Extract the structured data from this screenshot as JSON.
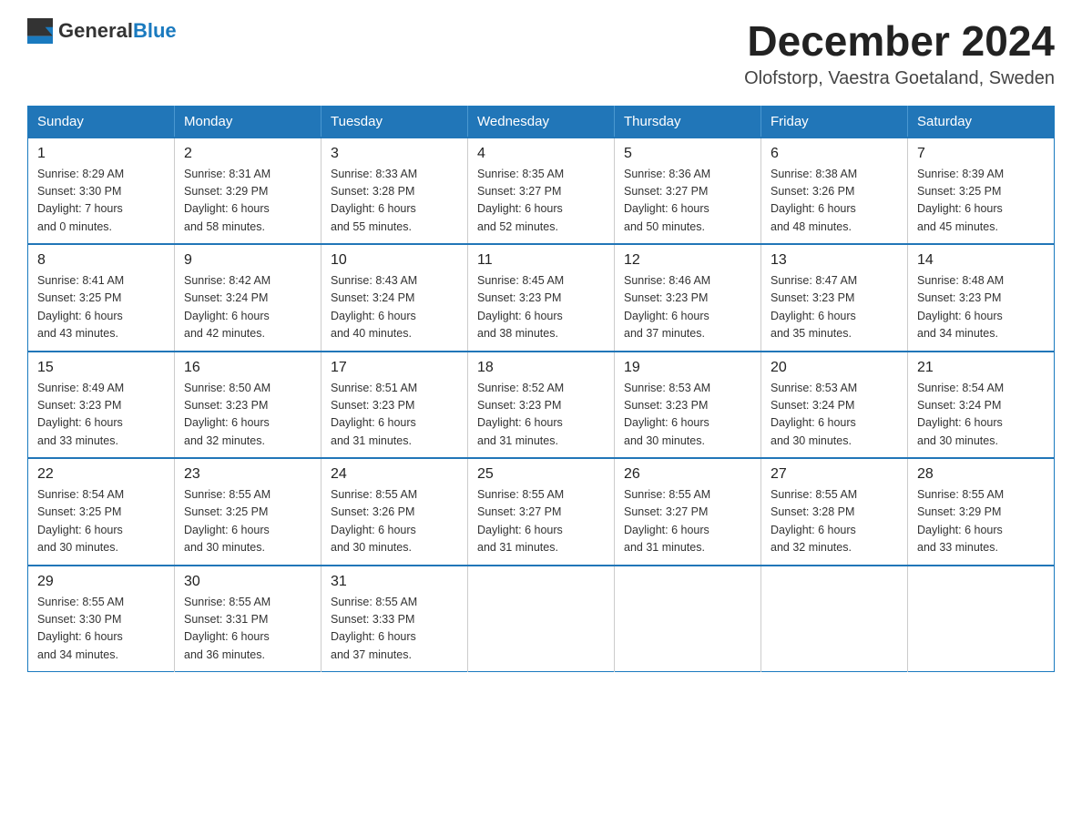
{
  "logo": {
    "text_general": "General",
    "text_blue": "Blue",
    "icon_alt": "GeneralBlue logo"
  },
  "header": {
    "month_title": "December 2024",
    "location": "Olofstorp, Vaestra Goetaland, Sweden"
  },
  "weekdays": [
    "Sunday",
    "Monday",
    "Tuesday",
    "Wednesday",
    "Thursday",
    "Friday",
    "Saturday"
  ],
  "weeks": [
    [
      {
        "day": "1",
        "sunrise": "8:29 AM",
        "sunset": "3:30 PM",
        "daylight": "7 hours and 0 minutes."
      },
      {
        "day": "2",
        "sunrise": "8:31 AM",
        "sunset": "3:29 PM",
        "daylight": "6 hours and 58 minutes."
      },
      {
        "day": "3",
        "sunrise": "8:33 AM",
        "sunset": "3:28 PM",
        "daylight": "6 hours and 55 minutes."
      },
      {
        "day": "4",
        "sunrise": "8:35 AM",
        "sunset": "3:27 PM",
        "daylight": "6 hours and 52 minutes."
      },
      {
        "day": "5",
        "sunrise": "8:36 AM",
        "sunset": "3:27 PM",
        "daylight": "6 hours and 50 minutes."
      },
      {
        "day": "6",
        "sunrise": "8:38 AM",
        "sunset": "3:26 PM",
        "daylight": "6 hours and 48 minutes."
      },
      {
        "day": "7",
        "sunrise": "8:39 AM",
        "sunset": "3:25 PM",
        "daylight": "6 hours and 45 minutes."
      }
    ],
    [
      {
        "day": "8",
        "sunrise": "8:41 AM",
        "sunset": "3:25 PM",
        "daylight": "6 hours and 43 minutes."
      },
      {
        "day": "9",
        "sunrise": "8:42 AM",
        "sunset": "3:24 PM",
        "daylight": "6 hours and 42 minutes."
      },
      {
        "day": "10",
        "sunrise": "8:43 AM",
        "sunset": "3:24 PM",
        "daylight": "6 hours and 40 minutes."
      },
      {
        "day": "11",
        "sunrise": "8:45 AM",
        "sunset": "3:23 PM",
        "daylight": "6 hours and 38 minutes."
      },
      {
        "day": "12",
        "sunrise": "8:46 AM",
        "sunset": "3:23 PM",
        "daylight": "6 hours and 37 minutes."
      },
      {
        "day": "13",
        "sunrise": "8:47 AM",
        "sunset": "3:23 PM",
        "daylight": "6 hours and 35 minutes."
      },
      {
        "day": "14",
        "sunrise": "8:48 AM",
        "sunset": "3:23 PM",
        "daylight": "6 hours and 34 minutes."
      }
    ],
    [
      {
        "day": "15",
        "sunrise": "8:49 AM",
        "sunset": "3:23 PM",
        "daylight": "6 hours and 33 minutes."
      },
      {
        "day": "16",
        "sunrise": "8:50 AM",
        "sunset": "3:23 PM",
        "daylight": "6 hours and 32 minutes."
      },
      {
        "day": "17",
        "sunrise": "8:51 AM",
        "sunset": "3:23 PM",
        "daylight": "6 hours and 31 minutes."
      },
      {
        "day": "18",
        "sunrise": "8:52 AM",
        "sunset": "3:23 PM",
        "daylight": "6 hours and 31 minutes."
      },
      {
        "day": "19",
        "sunrise": "8:53 AM",
        "sunset": "3:23 PM",
        "daylight": "6 hours and 30 minutes."
      },
      {
        "day": "20",
        "sunrise": "8:53 AM",
        "sunset": "3:24 PM",
        "daylight": "6 hours and 30 minutes."
      },
      {
        "day": "21",
        "sunrise": "8:54 AM",
        "sunset": "3:24 PM",
        "daylight": "6 hours and 30 minutes."
      }
    ],
    [
      {
        "day": "22",
        "sunrise": "8:54 AM",
        "sunset": "3:25 PM",
        "daylight": "6 hours and 30 minutes."
      },
      {
        "day": "23",
        "sunrise": "8:55 AM",
        "sunset": "3:25 PM",
        "daylight": "6 hours and 30 minutes."
      },
      {
        "day": "24",
        "sunrise": "8:55 AM",
        "sunset": "3:26 PM",
        "daylight": "6 hours and 30 minutes."
      },
      {
        "day": "25",
        "sunrise": "8:55 AM",
        "sunset": "3:27 PM",
        "daylight": "6 hours and 31 minutes."
      },
      {
        "day": "26",
        "sunrise": "8:55 AM",
        "sunset": "3:27 PM",
        "daylight": "6 hours and 31 minutes."
      },
      {
        "day": "27",
        "sunrise": "8:55 AM",
        "sunset": "3:28 PM",
        "daylight": "6 hours and 32 minutes."
      },
      {
        "day": "28",
        "sunrise": "8:55 AM",
        "sunset": "3:29 PM",
        "daylight": "6 hours and 33 minutes."
      }
    ],
    [
      {
        "day": "29",
        "sunrise": "8:55 AM",
        "sunset": "3:30 PM",
        "daylight": "6 hours and 34 minutes."
      },
      {
        "day": "30",
        "sunrise": "8:55 AM",
        "sunset": "3:31 PM",
        "daylight": "6 hours and 36 minutes."
      },
      {
        "day": "31",
        "sunrise": "8:55 AM",
        "sunset": "3:33 PM",
        "daylight": "6 hours and 37 minutes."
      },
      null,
      null,
      null,
      null
    ]
  ],
  "labels": {
    "sunrise": "Sunrise:",
    "sunset": "Sunset:",
    "daylight": "Daylight:"
  }
}
